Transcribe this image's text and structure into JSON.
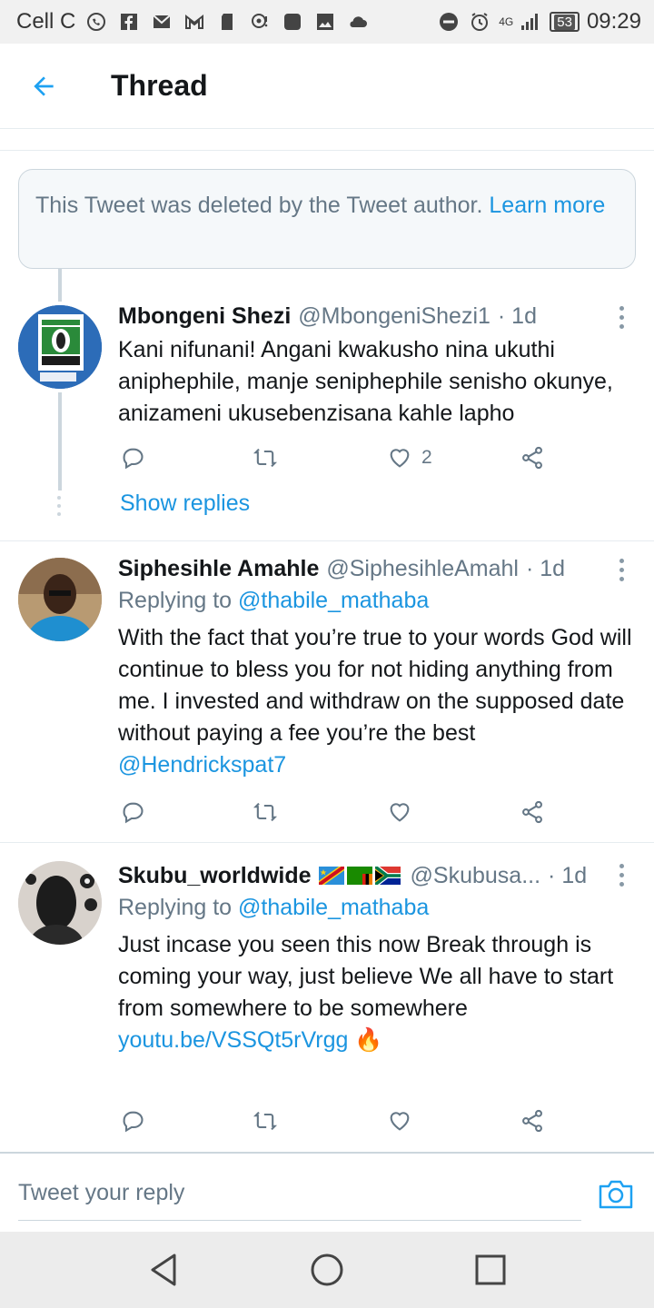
{
  "status_bar": {
    "carrier": "Cell C",
    "network": "4G",
    "battery": "53",
    "time": "09:29"
  },
  "header": {
    "title": "Thread",
    "back_icon": "arrow-left-icon"
  },
  "deleted_notice": {
    "text": "This Tweet was deleted by the Tweet author.",
    "link": "Learn more"
  },
  "tweets": [
    {
      "name": "Mbongeni Shezi",
      "handle": "@MbongeniShezi1",
      "time": "· 1d",
      "replying_label": "",
      "replying_to": "",
      "text": "Kani nifunani! Angani kwakusho nina ukuthi aniphephile, manje seniphephile senisho okunye, anizameni ukusebenzisana kahle lapho",
      "mention": "",
      "link": "",
      "likes": "2",
      "show_replies": "Show replies"
    },
    {
      "name": "Siphesihle Amahle",
      "handle": "@SiphesihleAmahl",
      "time": "· 1d",
      "replying_label": "Replying to",
      "replying_to": "@thabile_mathaba",
      "text": "With the fact that you’re true to your words God will continue to bless you for not hiding anything from me. I invested and withdraw on the supposed date without paying a fee you’re the best",
      "mention": "@Hendrickspat7",
      "link": "",
      "likes": "",
      "show_replies": ""
    },
    {
      "name": "Skubu_worldwide",
      "handle": "@Skubusa...",
      "time": "· 1d",
      "replying_label": "Replying to",
      "replying_to": "@thabile_mathaba",
      "text": "Just incase you seen this now Break through is coming your way, just believe We all have to start from somewhere to be somewhere",
      "mention": "",
      "link": "youtu.be/VSSQt5rVrgg",
      "emoji": "🔥",
      "likes": "",
      "show_replies": ""
    }
  ],
  "reply_bar": {
    "placeholder": "Tweet your reply",
    "camera_icon": "camera-icon"
  },
  "colors": {
    "accent": "#1b95e0",
    "muted": "#657786",
    "border": "#e6ecf0"
  }
}
